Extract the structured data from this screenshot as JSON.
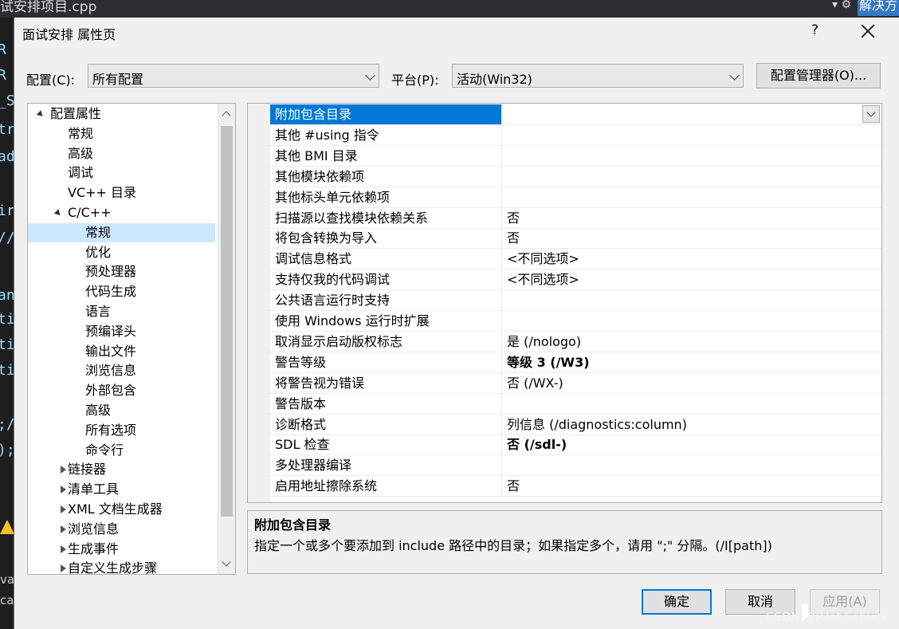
{
  "ide": {
    "file_tab": "试安排项目.cpp",
    "solve_button": "解决方",
    "code_fragments": [
      "R",
      "R",
      "_S",
      "tr",
      "ad",
      "ir",
      "//",
      "an",
      "ti",
      "ti",
      "ti",
      ";/",
      ");"
    ],
    "bottom_fragments": [
      "var",
      "cal"
    ]
  },
  "dialog": {
    "title": "面试安排 属性页",
    "help": "?",
    "config_label": "配置(C):",
    "config_value": "所有配置",
    "platform_label": "平台(P):",
    "platform_value": "活动(Win32)",
    "config_manager": "配置管理器(O)..."
  },
  "tree": {
    "items": [
      {
        "label": "配置属性",
        "level": 0,
        "state": "expanded"
      },
      {
        "label": "常规",
        "level": 1
      },
      {
        "label": "高级",
        "level": 1
      },
      {
        "label": "调试",
        "level": 1
      },
      {
        "label": "VC++ 目录",
        "level": 1
      },
      {
        "label": "C/C++",
        "level": 1,
        "state": "expanded"
      },
      {
        "label": "常规",
        "level": 2,
        "selected": true
      },
      {
        "label": "优化",
        "level": 2
      },
      {
        "label": "预处理器",
        "level": 2
      },
      {
        "label": "代码生成",
        "level": 2
      },
      {
        "label": "语言",
        "level": 2
      },
      {
        "label": "预编译头",
        "level": 2
      },
      {
        "label": "输出文件",
        "level": 2
      },
      {
        "label": "浏览信息",
        "level": 2
      },
      {
        "label": "外部包含",
        "level": 2
      },
      {
        "label": "高级",
        "level": 2
      },
      {
        "label": "所有选项",
        "level": 2
      },
      {
        "label": "命令行",
        "level": 2
      },
      {
        "label": "链接器",
        "level": 1,
        "state": "collapsed"
      },
      {
        "label": "清单工具",
        "level": 1,
        "state": "collapsed"
      },
      {
        "label": "XML 文档生成器",
        "level": 1,
        "state": "collapsed"
      },
      {
        "label": "浏览信息",
        "level": 1,
        "state": "collapsed"
      },
      {
        "label": "生成事件",
        "level": 1,
        "state": "collapsed"
      },
      {
        "label": "自定义生成步骤",
        "level": 1,
        "state": "collapsed"
      }
    ]
  },
  "props": [
    {
      "name": "附加包含目录",
      "value": "",
      "selected": true
    },
    {
      "name": "其他 #using 指令",
      "value": ""
    },
    {
      "name": "其他 BMI 目录",
      "value": ""
    },
    {
      "name": "其他模块依赖项",
      "value": ""
    },
    {
      "name": "其他标头单元依赖项",
      "value": ""
    },
    {
      "name": "扫描源以查找模块依赖关系",
      "value": "否"
    },
    {
      "name": "将包含转换为导入",
      "value": "否"
    },
    {
      "name": "调试信息格式",
      "value": "<不同选项>"
    },
    {
      "name": "支持仅我的代码调试",
      "value": "<不同选项>"
    },
    {
      "name": "公共语言运行时支持",
      "value": ""
    },
    {
      "name": "使用 Windows 运行时扩展",
      "value": ""
    },
    {
      "name": "取消显示启动版权标志",
      "value": "是 (/nologo)"
    },
    {
      "name": "警告等级",
      "value": "等级 3 (/W3)",
      "bold": true
    },
    {
      "name": "将警告视为错误",
      "value": "否 (/WX-)"
    },
    {
      "name": "警告版本",
      "value": ""
    },
    {
      "name": "诊断格式",
      "value": "列信息 (/diagnostics:column)"
    },
    {
      "name": "SDL 检查",
      "value": "否 (/sdl-)",
      "bold": true
    },
    {
      "name": "多处理器编译",
      "value": ""
    },
    {
      "name": "启用地址擦除系统",
      "value": "否"
    }
  ],
  "description": {
    "title": "附加包含目录",
    "body": "指定一个或多个要添加到 include 路径中的目录；如果指定多个，请用 \";\" 分隔。(/I[path])"
  },
  "buttons": {
    "ok": "确定",
    "cancel": "取消",
    "apply": "应用(A)"
  },
  "watermark": "CSDN @Pilot Schuck",
  "colors": {
    "selection": "#0078d7",
    "tree_selection": "#cce8ff",
    "annotation": "#e8101a"
  }
}
